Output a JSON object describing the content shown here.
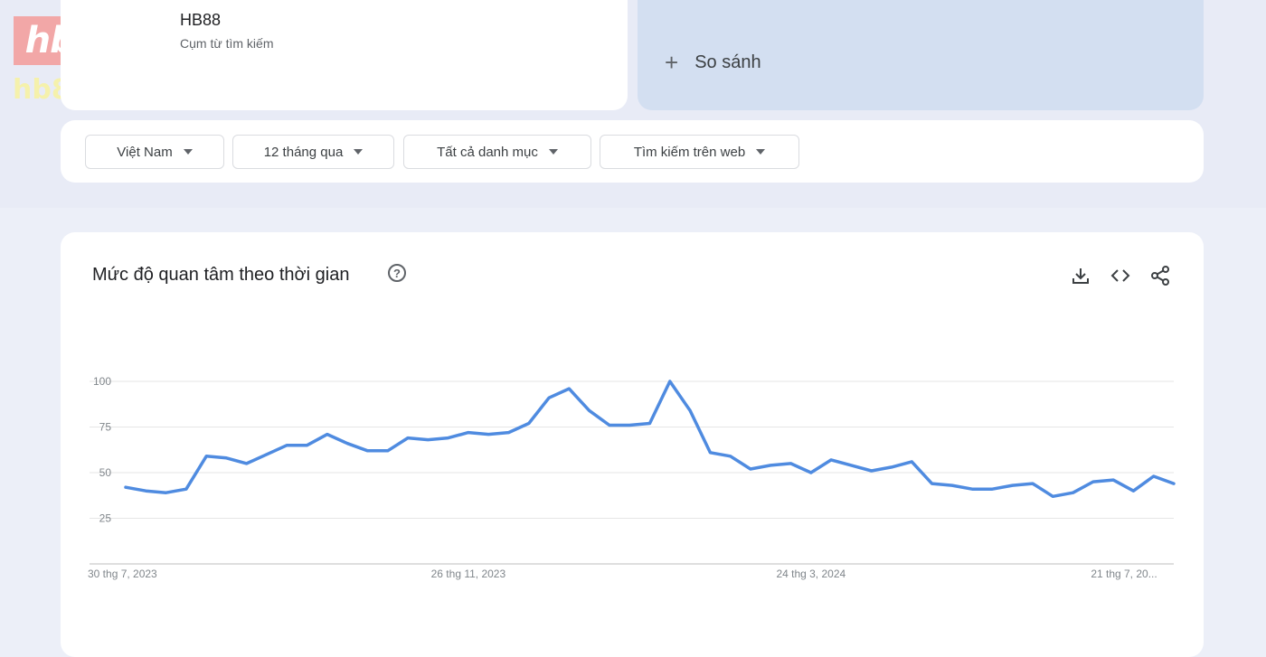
{
  "watermark": {
    "logo_hb": "hb",
    "logo_88": "88",
    "url": "hb88.fit"
  },
  "search_term": {
    "name": "HB88",
    "subtitle": "Cụm từ tìm kiếm"
  },
  "compare": {
    "label": "So sánh"
  },
  "filters": [
    {
      "label": "Việt Nam"
    },
    {
      "label": "12 tháng qua"
    },
    {
      "label": "Tất cả danh mục"
    },
    {
      "label": "Tìm kiếm trên web"
    }
  ],
  "chart_panel": {
    "title": "Mức độ quan tâm theo thời gian"
  },
  "icons": {
    "help": "help-circle-icon",
    "download": "download-icon",
    "embed": "code-embed-icon",
    "share": "share-icon"
  },
  "colors": {
    "line": "#4f8be0",
    "compare_bg": "#d3dff1"
  },
  "chart_data": {
    "type": "line",
    "title": "",
    "xlabel": "",
    "ylabel": "",
    "ylim": [
      0,
      100
    ],
    "grid": true,
    "y_ticks": [
      25,
      50,
      75,
      100
    ],
    "x_tick_labels": [
      "30 thg 7, 2023",
      "26 thg 11, 2023",
      "24 thg 3, 2024",
      "21 thg 7, 20..."
    ],
    "x_tick_indices": [
      0,
      17,
      34,
      51
    ],
    "series": [
      {
        "name": "",
        "values": [
          42,
          40,
          39,
          41,
          59,
          58,
          55,
          60,
          65,
          65,
          71,
          66,
          62,
          62,
          69,
          68,
          69,
          72,
          71,
          72,
          77,
          91,
          96,
          84,
          76,
          76,
          77,
          100,
          84,
          61,
          59,
          52,
          54,
          55,
          50,
          57,
          54,
          51,
          53,
          56,
          44,
          43,
          41,
          41,
          43,
          44,
          37,
          39,
          45,
          46,
          40,
          48,
          44
        ]
      }
    ]
  }
}
